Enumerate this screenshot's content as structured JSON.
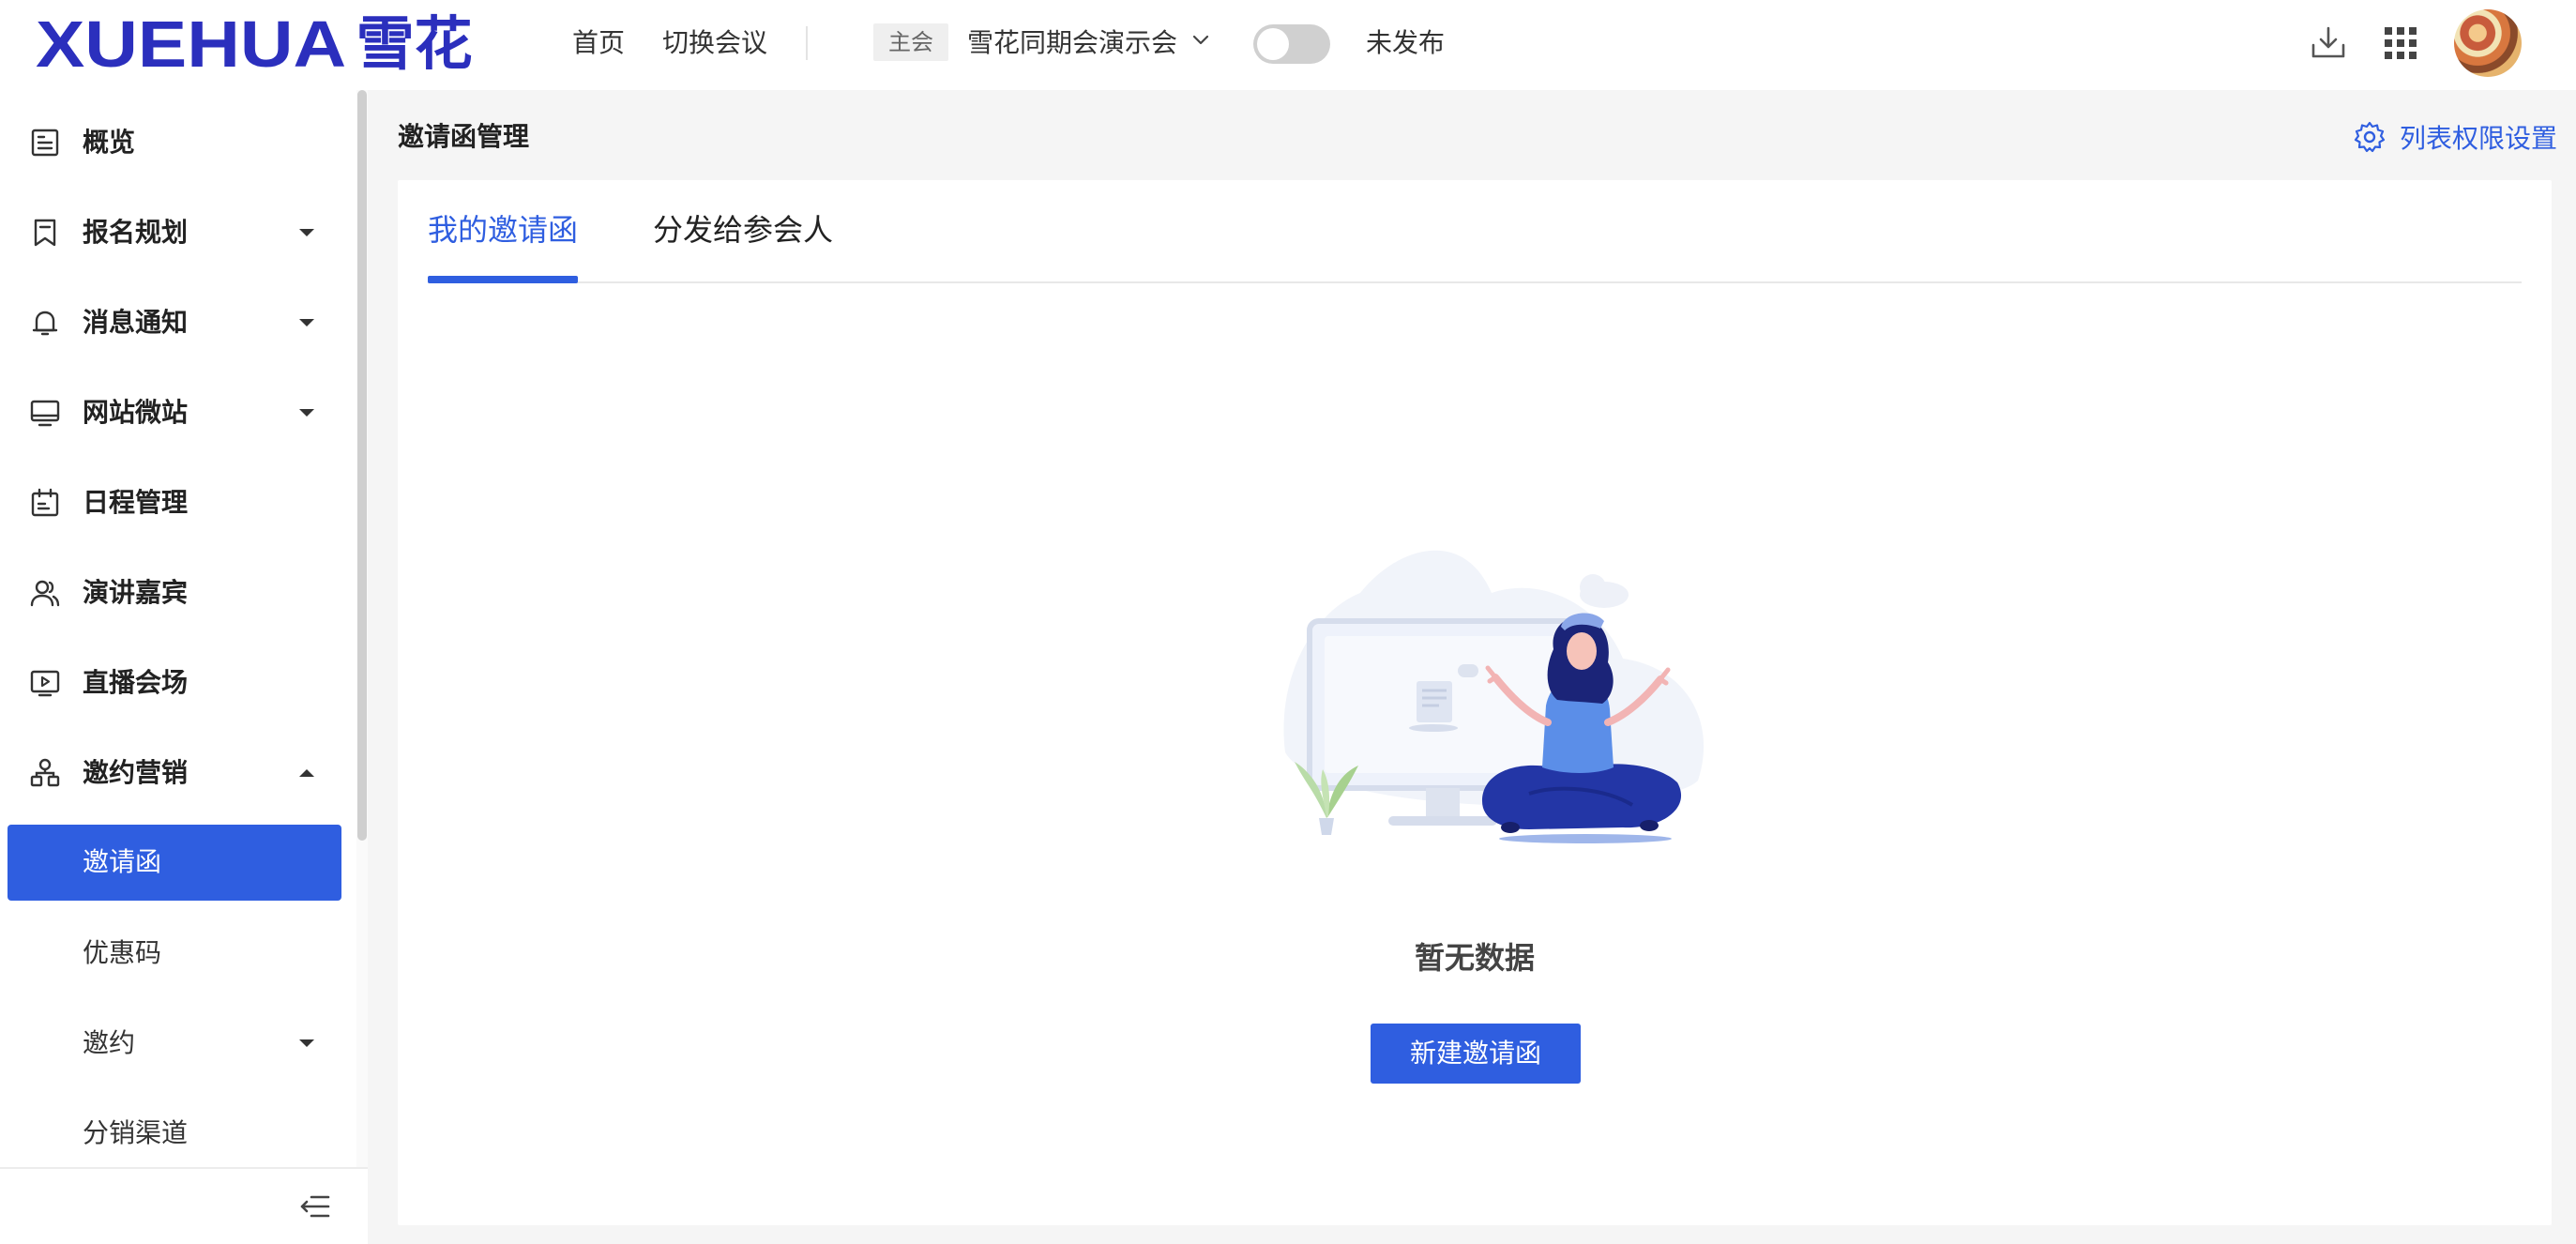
{
  "header": {
    "logo_latin": "XUEHUA",
    "logo_cn": "雪花",
    "nav": {
      "home": "首页",
      "switch_meeting": "切换会议"
    },
    "meeting_tag": "主会",
    "meeting_name": "雪花同期会演示会",
    "publish_status": "未发布",
    "icons": [
      "download-icon",
      "apps-grid-icon",
      "avatar"
    ]
  },
  "sidebar": {
    "items": [
      {
        "label": "概览",
        "icon": "overview-icon",
        "expandable": false
      },
      {
        "label": "报名规划",
        "icon": "bookmark-icon",
        "expandable": true,
        "expanded": false
      },
      {
        "label": "消息通知",
        "icon": "bell-icon",
        "expandable": true,
        "expanded": false
      },
      {
        "label": "网站微站",
        "icon": "monitor-icon",
        "expandable": true,
        "expanded": false
      },
      {
        "label": "日程管理",
        "icon": "calendar-icon",
        "expandable": false
      },
      {
        "label": "演讲嘉宾",
        "icon": "users-icon",
        "expandable": false
      },
      {
        "label": "直播会场",
        "icon": "live-icon",
        "expandable": false
      },
      {
        "label": "邀约营销",
        "icon": "org-icon",
        "expandable": true,
        "expanded": true
      }
    ],
    "subitems": [
      {
        "label": "邀请函",
        "active": true
      },
      {
        "label": "优惠码"
      },
      {
        "label": "邀约",
        "expandable": true
      },
      {
        "label": "分销渠道"
      }
    ]
  },
  "page": {
    "title": "邀请函管理",
    "permission_link": "列表权限设置",
    "tabs": [
      {
        "label": "我的邀请函",
        "active": true
      },
      {
        "label": "分发给参会人",
        "active": false
      }
    ],
    "empty_text": "暂无数据",
    "new_button": "新建邀请函"
  },
  "colors": {
    "primary": "#2f5ee0",
    "logo": "#2b2fbd",
    "background": "#f5f5f5"
  }
}
